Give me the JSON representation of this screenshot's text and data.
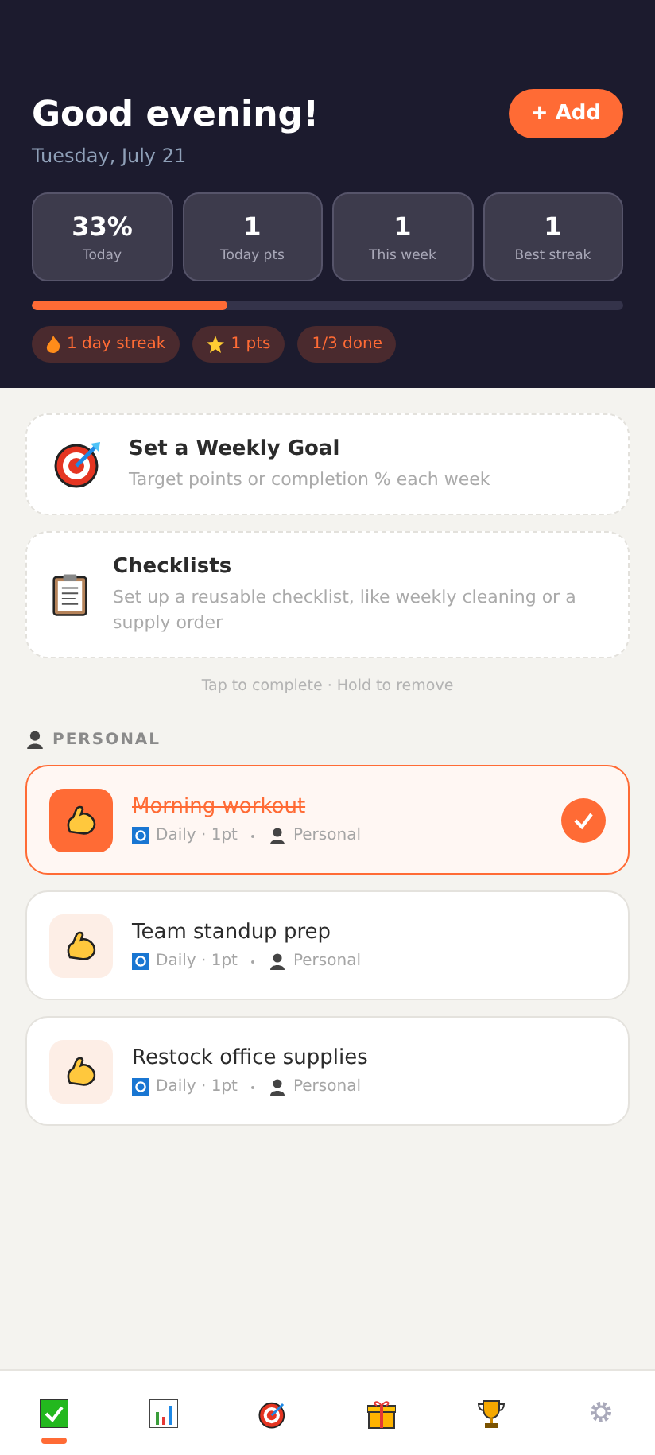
{
  "header": {
    "greeting": "Good evening!",
    "date": "Tuesday, July 21",
    "add_button": "+ Add"
  },
  "stats": [
    {
      "value": "33%",
      "label": "Today"
    },
    {
      "value": "1",
      "label": "Today pts"
    },
    {
      "value": "1",
      "label": "This week"
    },
    {
      "value": "1",
      "label": "Best streak"
    }
  ],
  "progress": {
    "level": 0.33
  },
  "chips": [
    {
      "kind": "streak",
      "label": "1 day streak"
    },
    {
      "kind": "points",
      "label": "1 pts"
    },
    {
      "kind": "plain",
      "label": "1/3 done"
    }
  ],
  "promos": [
    {
      "kind": "goal",
      "title": "Set a Weekly Goal",
      "subtitle": "Target points or completion % each week"
    },
    {
      "kind": "checklist",
      "title": "Checklists",
      "subtitle": "Set up a reusable checklist, like weekly cleaning or a supply order"
    }
  ],
  "hint": "Tap to complete · Hold to remove",
  "section": {
    "title": "PERSONAL"
  },
  "tasks": [
    {
      "title": "Morning workout",
      "meta": "Daily · 1pt",
      "category": "Personal",
      "checked": true
    },
    {
      "title": "Team standup prep",
      "meta": "Daily · 1pt",
      "category": "Personal",
      "checked": false
    },
    {
      "title": "Restock office supplies",
      "meta": "Daily · 1pt",
      "category": "Personal",
      "checked": false
    }
  ],
  "nav": [
    {
      "kind": "today",
      "selected": true
    },
    {
      "kind": "progress",
      "selected": false
    },
    {
      "kind": "goals",
      "selected": false
    },
    {
      "kind": "rewards",
      "selected": false
    },
    {
      "kind": "ranks",
      "selected": false
    },
    {
      "kind": "settings",
      "selected": false
    }
  ]
}
